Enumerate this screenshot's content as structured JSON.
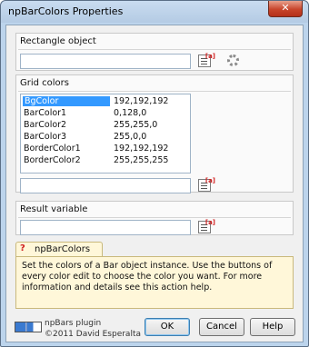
{
  "window": {
    "title": "npBarColors Properties",
    "close_glyph": "✕"
  },
  "rectangle_group": {
    "label": "Rectangle object",
    "value": ""
  },
  "grid_group": {
    "label": "Grid colors",
    "rows": [
      {
        "name": "BgColor",
        "value": "192,192,192",
        "selected": true
      },
      {
        "name": "BarColor1",
        "value": "0,128,0"
      },
      {
        "name": "BarColor2",
        "value": "255,255,0"
      },
      {
        "name": "BarColor3",
        "value": "255,0,0"
      },
      {
        "name": "BorderColor1",
        "value": "192,192,192"
      },
      {
        "name": "BorderColor2",
        "value": "255,255,255"
      }
    ],
    "edit_value": ""
  },
  "result_group": {
    "label": "Result variable",
    "value": ""
  },
  "info": {
    "tab_label": "npBarColors",
    "text": "Set the colors of a Bar object instance. Use the buttons of every color edit to choose the color you want. For more information and details see this action help."
  },
  "footer": {
    "plugin_name": "npBars plugin",
    "copyright": "©2011 David Esperalta",
    "ok_label": "OK",
    "cancel_label": "Cancel",
    "help_label": "Help"
  },
  "icons": {
    "variable": "variable-picker-icon",
    "gear": "gear-icon",
    "help": "question-icon"
  },
  "colors": {
    "selection": "#3399ff",
    "info_bg": "#fff7d9",
    "close": "#c8452b"
  }
}
